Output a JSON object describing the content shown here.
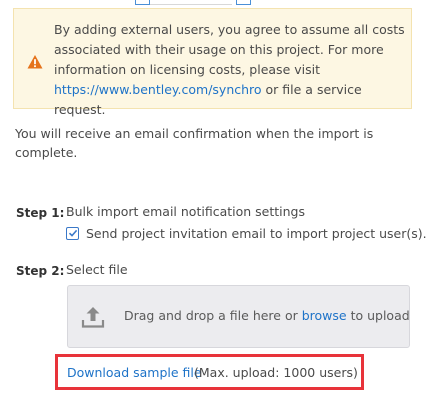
{
  "warning": {
    "text_before_link": "By adding external users, you agree to assume all costs associated with their usage on this project. For more information on licensing costs, please visit ",
    "link_text": "https://www.bentley.com/synchro",
    "text_after_link": " or file a service request."
  },
  "confirmation": {
    "text": "You will receive an email confirmation when the import is complete."
  },
  "step1": {
    "label": "Step 1:",
    "description": "Bulk import email notification settings",
    "checkbox_label": "Send project invitation email to import project user(s).",
    "checked": true
  },
  "step2": {
    "label": "Step 2:",
    "description": "Select file",
    "dropzone_text_before": "Drag and drop a file here or ",
    "browse_link": "browse",
    "dropzone_text_after": " to upload"
  },
  "download": {
    "link_text": "Download sample file",
    "note": "(Max. upload: 1000 users)",
    "highlight_color": "#e8333a"
  },
  "colors": {
    "link": "#1e73c8",
    "warning_bg": "#fdf7e3",
    "warning_icon": "#e5731b",
    "checkbox": "#3a78c8"
  },
  "icons": {
    "warning": "warning-triangle-icon",
    "upload": "upload-icon",
    "check": "checkmark-icon"
  }
}
